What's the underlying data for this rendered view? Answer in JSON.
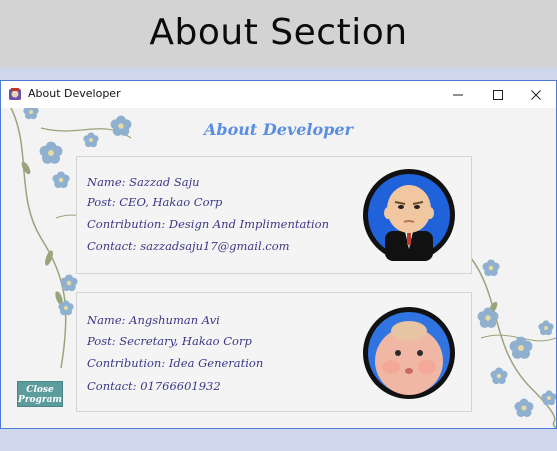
{
  "banner": {
    "title": "About Section"
  },
  "window": {
    "title": "About Developer",
    "controls": {
      "minimize": "—",
      "maximize": "☐",
      "close": "✕"
    }
  },
  "heading": "About Developer",
  "developers": [
    {
      "name": "Name: Sazzad Saju",
      "post": "Post: CEO, Hakao Corp",
      "contribution": "Contribution: Design And Implimentation",
      "contact": "Contact: sazzadsaju17@gmail.com",
      "avatar_icon": "boss-baby-avatar"
    },
    {
      "name": "Name: Angshuman Avi",
      "post": "Post: Secretary, Hakao Corp",
      "contribution": "Contribution: Idea Generation",
      "contact": "Contact: 01766601932",
      "avatar_icon": "chubby-baby-avatar"
    }
  ],
  "close_button": {
    "line1": "Close",
    "line2": "Program"
  },
  "colors": {
    "heading": "#5b8de0",
    "text": "#3b3787",
    "button": "#5c9c9c",
    "window_border": "#4d7bd1"
  }
}
